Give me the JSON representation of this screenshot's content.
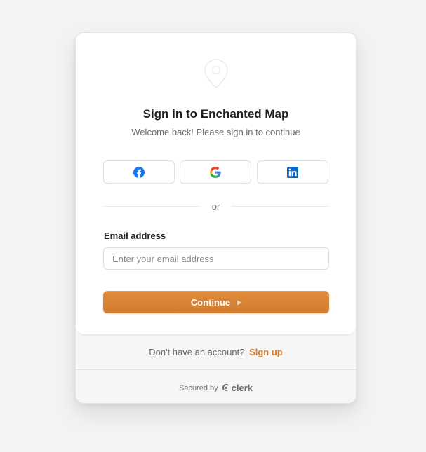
{
  "header": {
    "title": "Sign in to Enchanted Map",
    "subtitle": "Welcome back! Please sign in to continue"
  },
  "social": [
    {
      "provider": "Facebook",
      "icon": "facebook-icon",
      "color": "#1877F2"
    },
    {
      "provider": "Google",
      "icon": "google-icon"
    },
    {
      "provider": "LinkedIn",
      "icon": "linkedin-icon",
      "color": "#0A66C2"
    }
  ],
  "divider": {
    "text": "or"
  },
  "email": {
    "label": "Email address",
    "placeholder": "Enter your email address",
    "value": ""
  },
  "continue_button": {
    "label": "Continue",
    "icon": "play-arrow-icon",
    "color": "#d98535"
  },
  "signup": {
    "prompt": "Don't have an account?",
    "link": "Sign up"
  },
  "footer": {
    "secured_by": "Secured by",
    "brand": "clerk"
  },
  "colors": {
    "accent": "#d98535",
    "background": "#f3f3f3"
  }
}
